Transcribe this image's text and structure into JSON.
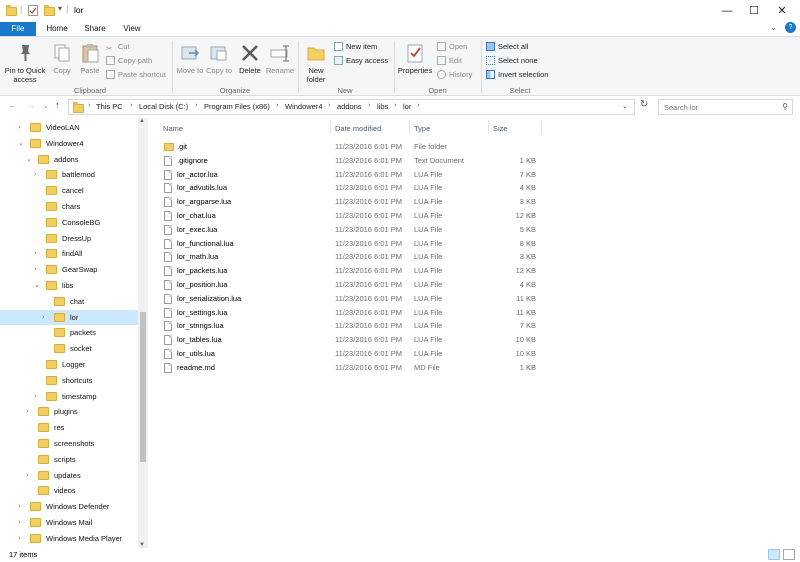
{
  "window": {
    "title": "lor",
    "minimize": "—",
    "maximize": "☐",
    "close": "✕"
  },
  "tabs": [
    "File",
    "Home",
    "Share",
    "View"
  ],
  "ribbon": {
    "clipboard": {
      "pin": "Pin to Quick access",
      "copy": "Copy",
      "paste": "Paste",
      "cut": "Cut",
      "copy_path": "Copy path",
      "paste_shortcut": "Paste shortcut",
      "label": "Clipboard"
    },
    "organize": {
      "move_to": "Move to",
      "copy_to": "Copy to",
      "delete": "Delete",
      "rename": "Rename",
      "label": "Organize"
    },
    "new": {
      "new_folder": "New folder",
      "new_item": "New item",
      "easy_access": "Easy access",
      "label": "New"
    },
    "open": {
      "properties": "Properties",
      "open": "Open",
      "edit": "Edit",
      "history": "History",
      "label": "Open"
    },
    "select": {
      "select_all": "Select all",
      "select_none": "Select none",
      "invert": "Invert selection",
      "label": "Select"
    }
  },
  "breadcrumb": [
    "This PC",
    "Local Disk (C:)",
    "Program Files (x86)",
    "Windower4",
    "addons",
    "libs",
    "lor"
  ],
  "search": {
    "placeholder": "Search lor"
  },
  "tree": [
    {
      "label": "VideoLAN",
      "twisty": "›"
    },
    {
      "label": "Windower4",
      "twisty": "⌄"
    },
    {
      "label": "addons",
      "twisty": "⌄"
    },
    {
      "label": "battlemod",
      "twisty": "›"
    },
    {
      "label": "cancel",
      "twisty": ""
    },
    {
      "label": "chars",
      "twisty": ""
    },
    {
      "label": "ConsoleBG",
      "twisty": ""
    },
    {
      "label": "DressUp",
      "twisty": ""
    },
    {
      "label": "findAll",
      "twisty": "›"
    },
    {
      "label": "GearSwap",
      "twisty": "›"
    },
    {
      "label": "libs",
      "twisty": "⌄"
    },
    {
      "label": "chat",
      "twisty": ""
    },
    {
      "label": "lor",
      "twisty": "›"
    },
    {
      "label": "packets",
      "twisty": ""
    },
    {
      "label": "socket",
      "twisty": ""
    },
    {
      "label": "Logger",
      "twisty": ""
    },
    {
      "label": "shortcuts",
      "twisty": ""
    },
    {
      "label": "timestamp",
      "twisty": "›"
    },
    {
      "label": "plugins",
      "twisty": "›"
    },
    {
      "label": "res",
      "twisty": ""
    },
    {
      "label": "screenshots",
      "twisty": ""
    },
    {
      "label": "scripts",
      "twisty": ""
    },
    {
      "label": "updates",
      "twisty": "›"
    },
    {
      "label": "videos",
      "twisty": ""
    },
    {
      "label": "Windows Defender",
      "twisty": "›"
    },
    {
      "label": "Windows Mail",
      "twisty": "›"
    },
    {
      "label": "Windows Media Player",
      "twisty": "›"
    }
  ],
  "columns": [
    "Name",
    "Date modified",
    "Type",
    "Size"
  ],
  "files": [
    {
      "name": ".git",
      "date": "11/23/2016 6:01 PM",
      "type": "File folder",
      "size": "",
      "kind": "folder"
    },
    {
      "name": ".gitignore",
      "date": "11/23/2016 6:01 PM",
      "type": "Text Document",
      "size": "1 KB",
      "kind": "file"
    },
    {
      "name": "lor_actor.lua",
      "date": "11/23/2016 6:01 PM",
      "type": "LUA File",
      "size": "7 KB",
      "kind": "file"
    },
    {
      "name": "lor_advutils.lua",
      "date": "11/23/2016 6:01 PM",
      "type": "LUA File",
      "size": "4 KB",
      "kind": "file"
    },
    {
      "name": "lor_argparse.lua",
      "date": "11/23/2016 6:01 PM",
      "type": "LUA File",
      "size": "3 KB",
      "kind": "file"
    },
    {
      "name": "lor_chat.lua",
      "date": "11/23/2016 6:01 PM",
      "type": "LUA File",
      "size": "12 KB",
      "kind": "file"
    },
    {
      "name": "lor_exec.lua",
      "date": "11/23/2016 6:01 PM",
      "type": "LUA File",
      "size": "5 KB",
      "kind": "file"
    },
    {
      "name": "lor_functional.lua",
      "date": "11/23/2016 6:01 PM",
      "type": "LUA File",
      "size": "8 KB",
      "kind": "file"
    },
    {
      "name": "lor_math.lua",
      "date": "11/23/2016 6:01 PM",
      "type": "LUA File",
      "size": "3 KB",
      "kind": "file"
    },
    {
      "name": "lor_packets.lua",
      "date": "11/23/2016 6:01 PM",
      "type": "LUA File",
      "size": "12 KB",
      "kind": "file"
    },
    {
      "name": "lor_position.lua",
      "date": "11/23/2016 6:01 PM",
      "type": "LUA File",
      "size": "4 KB",
      "kind": "file"
    },
    {
      "name": "lor_serialization.lua",
      "date": "11/23/2016 6:01 PM",
      "type": "LUA File",
      "size": "11 KB",
      "kind": "file"
    },
    {
      "name": "lor_settings.lua",
      "date": "11/23/2016 6:01 PM",
      "type": "LUA File",
      "size": "11 KB",
      "kind": "file"
    },
    {
      "name": "lor_strings.lua",
      "date": "11/23/2016 6:01 PM",
      "type": "LUA File",
      "size": "7 KB",
      "kind": "file"
    },
    {
      "name": "lor_tables.lua",
      "date": "11/23/2016 6:01 PM",
      "type": "LUA File",
      "size": "10 KB",
      "kind": "file"
    },
    {
      "name": "lor_utils.lua",
      "date": "11/23/2016 6:01 PM",
      "type": "LUA File",
      "size": "10 KB",
      "kind": "file"
    },
    {
      "name": "readme.md",
      "date": "11/23/2016 6:01 PM",
      "type": "MD File",
      "size": "1 KB",
      "kind": "file"
    }
  ],
  "status": {
    "count": "17 items"
  },
  "colors": {
    "accent": "#1979ca",
    "selection": "#cce8ff",
    "folder": "#f2cf62"
  }
}
